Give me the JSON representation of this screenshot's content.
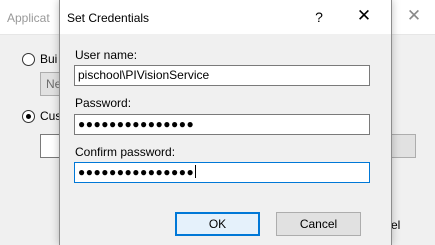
{
  "background_window": {
    "title_partial": "Applicat",
    "radio_1_label_partial": "Bui",
    "box_text_partial": "Ne",
    "radio_2_label_partial": "Cus",
    "right_button_partial": "el"
  },
  "dialog": {
    "title": "Set Credentials",
    "help_glyph": "?",
    "close_glyph": "✕",
    "user_name_label": "User name:",
    "user_name_value": "pischool\\PIVisionService",
    "password_label": "Password:",
    "password_value": "●●●●●●●●●●●●●●●",
    "confirm_label": "Confirm password:",
    "confirm_value": "●●●●●●●●●●●●●●●",
    "ok_label": "OK",
    "cancel_label": "Cancel"
  },
  "colors": {
    "focus_accent": "#0078d7",
    "dialog_bg": "#f0f0f0"
  }
}
